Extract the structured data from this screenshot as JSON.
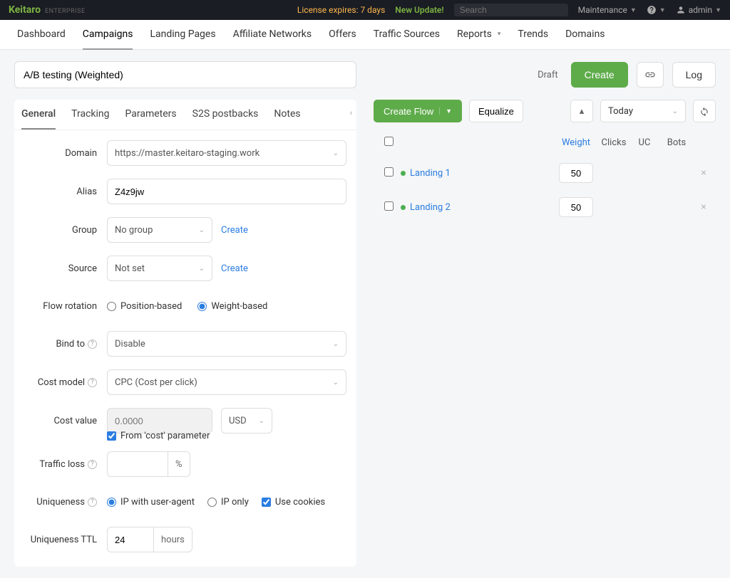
{
  "topbar": {
    "brand": "Keitaro",
    "brand_sub": "ENTERPRISE",
    "license": "License expires: 7 days",
    "update": "New Update!",
    "search_placeholder": "Search",
    "maintenance": "Maintenance",
    "admin": "admin"
  },
  "mainnav": {
    "items": [
      "Dashboard",
      "Campaigns",
      "Landing Pages",
      "Affiliate Networks",
      "Offers",
      "Traffic Sources",
      "Reports",
      "Trends",
      "Domains"
    ],
    "active_index": 1
  },
  "campaign": {
    "name": "A/B testing (Weighted)",
    "draft": "Draft",
    "create": "Create",
    "log": "Log"
  },
  "tabs": {
    "items": [
      "General",
      "Tracking",
      "Parameters",
      "S2S postbacks",
      "Notes"
    ],
    "active_index": 0
  },
  "form": {
    "domain_label": "Domain",
    "domain_value": "https://master.keitaro-staging.work",
    "alias_label": "Alias",
    "alias_value": "Z4z9jw",
    "group_label": "Group",
    "group_value": "No group",
    "group_create": "Create",
    "source_label": "Source",
    "source_value": "Not set",
    "source_create": "Create",
    "rotation_label": "Flow rotation",
    "rotation_position": "Position-based",
    "rotation_weight": "Weight-based",
    "bind_label": "Bind to",
    "bind_value": "Disable",
    "cost_model_label": "Cost model",
    "cost_model_value": "CPC (Cost per click)",
    "cost_value_label": "Cost value",
    "cost_value_placeholder": "0.0000",
    "cost_currency": "USD",
    "cost_from_param": "From 'cost' parameter",
    "traffic_loss_label": "Traffic loss",
    "traffic_loss_unit": "%",
    "uniqueness_label": "Uniqueness",
    "uniq_ip_ua": "IP with user-agent",
    "uniq_ip_only": "IP only",
    "uniq_cookies": "Use cookies",
    "ttl_label": "Uniqueness TTL",
    "ttl_value": "24",
    "ttl_unit": "hours"
  },
  "flows": {
    "create_flow": "Create Flow",
    "equalize": "Equalize",
    "period": "Today",
    "columns": {
      "weight": "Weight",
      "clicks": "Clicks",
      "uc": "UC",
      "bots": "Bots"
    },
    "rows": [
      {
        "name": "Landing 1",
        "weight": "50"
      },
      {
        "name": "Landing 2",
        "weight": "50"
      }
    ]
  }
}
